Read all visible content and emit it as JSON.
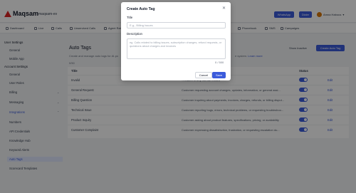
{
  "app": {
    "brand": "Maqsam",
    "workspace": "maqsam-ev"
  },
  "header": {
    "whatsapp_label": "WhatsApp",
    "dialer_label": "Dialer",
    "user_name": "Amna Habous",
    "accent_color": "#3b5bdb"
  },
  "nav": {
    "items": [
      {
        "label": "Dashboard"
      },
      {
        "label": "Live"
      },
      {
        "label": "Calls"
      },
      {
        "label": "Unserviced Calls"
      },
      {
        "label": "Agent Rat"
      },
      {
        "label": "Phonebook"
      },
      {
        "label": "SMS"
      },
      {
        "label": "Campaigns"
      }
    ]
  },
  "sidebar": {
    "user_settings": "User Settings",
    "general": "General",
    "mobile_app": "Mobile App",
    "account_settings": "Account Settings",
    "account_general": "General",
    "user_roles": "User Roles",
    "billing": "Billing",
    "messaging": "Messaging",
    "integrations": "Integrations",
    "numbers": "Numbers",
    "api_credentials": "API Credentials",
    "knowledge_hub": "Knowledge Hub",
    "keyword_alerts": "Keyword Alerts",
    "auto_tags": "Auto Tags",
    "scorecard_templates": "Scorecard Templates"
  },
  "main": {
    "title": "Auto Tags",
    "subtitle": "Create and manage auto tags for AI-po",
    "subtitle_tail": "e system.",
    "learn_more": "Learn more",
    "count": "0/50",
    "show_inactive": "Show Inactive",
    "create_button": "Create Auto Tag",
    "columns": {
      "title": "Title",
      "status": "Status"
    },
    "rows": [
      {
        "title": "Invalid",
        "description": "...related to any normal related",
        "edit": "Edit"
      },
      {
        "title": "General Request",
        "description": "Customer requesting account changes, updates, information, or general assi...",
        "edit": "Edit"
      },
      {
        "title": "Billing Question",
        "description": "Customer inquiring about payments, invoices, charges, refunds, or billing disput...",
        "edit": "Edit"
      },
      {
        "title": "Technical Issue",
        "description": "Customer reporting bugs, errors, technical problems, or requesting troubleshoo...",
        "edit": "Edit"
      },
      {
        "title": "Product Inquiry",
        "description": "Customer asking about product features, specifications, pricing, or availability",
        "edit": "Edit"
      },
      {
        "title": "Customer Complaint",
        "description": "Customer expressing dissatisfaction, frustration, or requesting escalation du...",
        "edit": "Edit"
      }
    ]
  },
  "modal": {
    "title": "Create Auto Tag",
    "title_label": "Title",
    "title_placeholder": "E.g., Billing Issues",
    "title_value": "",
    "description_label": "Description",
    "description_placeholder": "eg. Calls related to billing issues, subscription changes, refund requests, or questions about charges and invoices",
    "description_value": "",
    "counter": "0 / 500",
    "cancel_label": "Cancel",
    "save_label": "Save"
  }
}
